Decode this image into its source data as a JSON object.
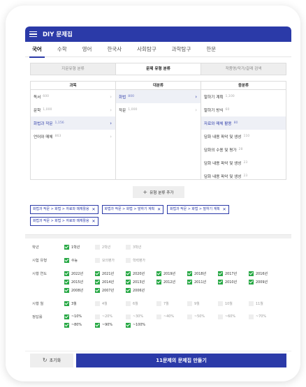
{
  "header": {
    "title": "DIY 문제집"
  },
  "subjects": [
    "국어",
    "수학",
    "영어",
    "한국사",
    "사회탐구",
    "과학탐구",
    "한문"
  ],
  "modes": [
    "지문유형 분류",
    "문제 유형 분류",
    "작품명/작가/갈래 검색"
  ],
  "columns": {
    "subject": {
      "title": "과목",
      "items": [
        {
          "label": "독서",
          "count": "600"
        },
        {
          "label": "문학",
          "count": "1,000"
        },
        {
          "label": "화법과 작문",
          "count": "1,156"
        },
        {
          "label": "언어와 매체",
          "count": "863"
        }
      ]
    },
    "major": {
      "title": "대분류",
      "items": [
        {
          "label": "화법",
          "count": "800"
        },
        {
          "label": "작문",
          "count": "1,000"
        }
      ]
    },
    "minor": {
      "title": "중분류",
      "items": [
        {
          "label": "말하기 계획",
          "count": "1,100"
        },
        {
          "label": "말하기 방식",
          "count": "60"
        },
        {
          "label": "자료와 매체 활용",
          "count": "80"
        },
        {
          "label": "담화 내용 파악 및 생성",
          "count": "110"
        },
        {
          "label": "담화의 수용 및 평가",
          "count": "28"
        },
        {
          "label": "담화 내용 파악 및 생성",
          "count": "23"
        },
        {
          "label": "담화 내용 파악 및 생성",
          "count": "23"
        }
      ]
    }
  },
  "add_button": "유형 분류 추가",
  "chips": [
    "화법과 작문 > 화법 > 자료와 매체활용",
    "화법과 작문 > 화법 > 말하기 계획",
    "화법과 작문 > 화법 > 말하기 계획",
    "화법과 작문 > 화법 > 자료와 매체활용"
  ],
  "filters": {
    "grade": {
      "label": "학년",
      "options": [
        {
          "label": "1학년",
          "checked": true
        },
        {
          "label": "2학년",
          "checked": false
        },
        {
          "label": "3학년",
          "checked": false
        }
      ]
    },
    "type": {
      "label": "시험 유형",
      "options": [
        {
          "label": "수능",
          "checked": true
        },
        {
          "label": "모의평가",
          "checked": false
        },
        {
          "label": "학력평가",
          "checked": false
        }
      ]
    },
    "year": {
      "label": "시행 연도",
      "options": [
        {
          "label": "2022년",
          "checked": true
        },
        {
          "label": "2021년",
          "checked": true
        },
        {
          "label": "2020년",
          "checked": true
        },
        {
          "label": "2019년",
          "checked": true
        },
        {
          "label": "2018년",
          "checked": true
        },
        {
          "label": "2017년",
          "checked": true
        },
        {
          "label": "2016년",
          "checked": true
        },
        {
          "label": "2015년",
          "checked": true
        },
        {
          "label": "2014년",
          "checked": true
        },
        {
          "label": "2013년",
          "checked": true
        },
        {
          "label": "2012년",
          "checked": true
        },
        {
          "label": "2011년",
          "checked": true
        },
        {
          "label": "2010년",
          "checked": true
        },
        {
          "label": "2009년",
          "checked": true
        },
        {
          "label": "2008년",
          "checked": true
        },
        {
          "label": "2007년",
          "checked": true
        },
        {
          "label": "2006년",
          "checked": true
        }
      ]
    },
    "month": {
      "label": "시행 월",
      "options": [
        {
          "label": "3월",
          "checked": true
        },
        {
          "label": "4월",
          "checked": false
        },
        {
          "label": "6월",
          "checked": false
        },
        {
          "label": "7월",
          "checked": false
        },
        {
          "label": "9월",
          "checked": false
        },
        {
          "label": "10월",
          "checked": false
        },
        {
          "label": "11월",
          "checked": false
        }
      ]
    },
    "rate": {
      "label": "정답률",
      "options": [
        {
          "label": "~10%",
          "checked": true
        },
        {
          "label": "~20%",
          "checked": false
        },
        {
          "label": "~30%",
          "checked": false
        },
        {
          "label": "~40%",
          "checked": false
        },
        {
          "label": "~50%",
          "checked": false
        },
        {
          "label": "~60%",
          "checked": false
        },
        {
          "label": "~70%",
          "checked": false
        },
        {
          "label": "~80%",
          "checked": true
        },
        {
          "label": "~90%",
          "checked": true
        },
        {
          "label": "~100%",
          "checked": true
        }
      ]
    }
  },
  "footer": {
    "reset": "초기화",
    "make": "11문제의 문제집 만들기"
  },
  "colors": {
    "brand": "#2b3aa8",
    "check": "#27a844"
  }
}
